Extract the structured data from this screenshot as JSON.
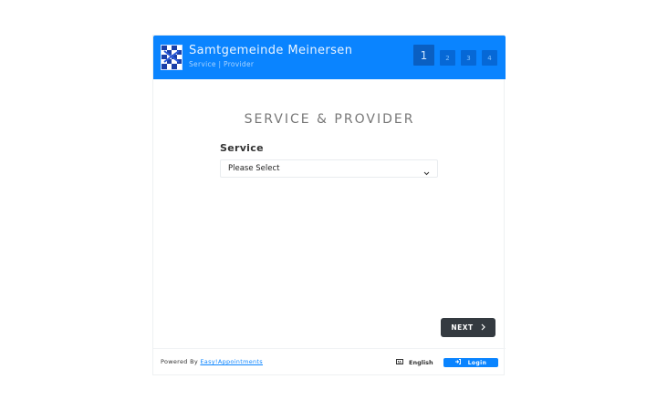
{
  "header": {
    "company_name": "Samtgemeinde Meinersen",
    "subtitle": "Service | Provider",
    "logo_icon": "crest-logo-icon",
    "background_color": "#0a84ff",
    "steps": [
      {
        "label": "1",
        "active": true
      },
      {
        "label": "2",
        "active": false
      },
      {
        "label": "3",
        "active": false
      },
      {
        "label": "4",
        "active": false
      }
    ]
  },
  "main": {
    "title": "SERVICE & PROVIDER",
    "service_label": "Service",
    "service_select": {
      "selected": "Please Select",
      "icon": "chevron-down-icon"
    },
    "next_button": {
      "label": "NEXT",
      "icon": "chevron-right-icon",
      "color": "#343a40"
    }
  },
  "footer": {
    "powered_by": "Powered By",
    "powered_link": "Easy!Appointments",
    "language": {
      "label": "English",
      "icon": "keyboard-icon"
    },
    "login_button": {
      "label": "Login",
      "icon": "login-icon",
      "color": "#0a84ff"
    }
  }
}
